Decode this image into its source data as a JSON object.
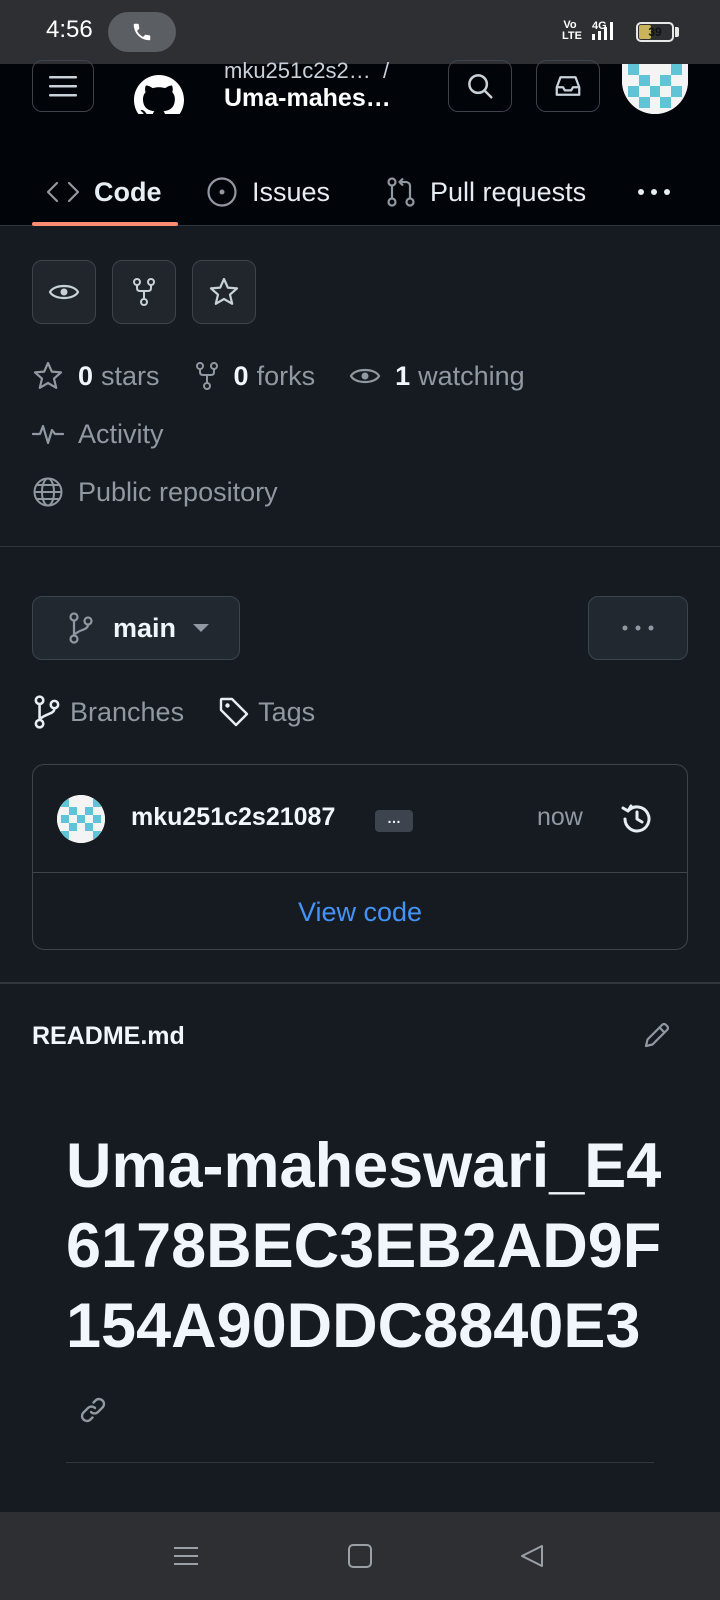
{
  "status_bar": {
    "time": "4:56",
    "volte": "Vo LTE",
    "network": "4G",
    "battery": "39",
    "battery_level": 0.39
  },
  "header": {
    "owner": "mku251c2s2…",
    "separator": "/",
    "repo": "Uma-mahes…"
  },
  "tabs": [
    {
      "label": "Code",
      "icon": "code-icon",
      "active": true
    },
    {
      "label": "Issues",
      "icon": "issue-icon",
      "active": false
    },
    {
      "label": "Pull requests",
      "icon": "pull-request-icon",
      "active": false
    }
  ],
  "stats": {
    "stars_count": "0",
    "stars_label": "stars",
    "forks_count": "0",
    "forks_label": "forks",
    "watching_count": "1",
    "watching_label": "watching",
    "activity": "Activity",
    "visibility": "Public repository"
  },
  "branch": {
    "name": "main",
    "branches_label": "Branches",
    "tags_label": "Tags"
  },
  "commit": {
    "author": "mku251c2s21087",
    "ellipsis": "…",
    "time": "now",
    "view_code": "View code"
  },
  "readme": {
    "file_name": "README.md",
    "heading": "Uma-maheswari_E46178BEC3EB2AD9F154A90DDC8840E3"
  },
  "colors": {
    "accent_underline": "#fd8c73",
    "link": "#4493f8",
    "background": "#161b22",
    "header_bg": "#010409",
    "avatar_teal": "#5fc4d6"
  }
}
